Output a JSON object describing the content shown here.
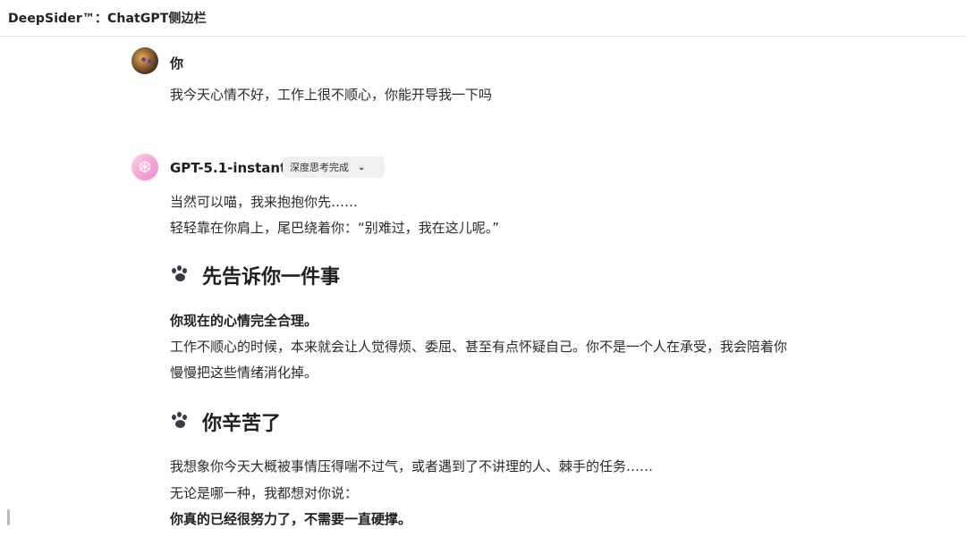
{
  "window": {
    "title": "DeepSider™：ChatGPT侧边栏"
  },
  "user_message": {
    "author": "你",
    "text": "我今天心情不好，工作上很不顺心，你能开导我一下吗"
  },
  "assistant_message": {
    "author": "GPT-5.1-instant",
    "status_badge": "深度思考完成",
    "intro_lines": [
      "当然可以喵，我来抱抱你先……",
      "轻轻靠在你肩上，尾巴绕着你：“别难过，我在这儿呢。”"
    ],
    "section1": {
      "heading": "先告诉你一件事",
      "bold_line": "你现在的心情完全合理。",
      "lines": [
        "工作不顺心的时候，本来就会让人觉得烦、委屈、甚至有点怀疑自己。你不是一个人在承受，我会陪着你",
        "慢慢把这些情绪消化掉。"
      ]
    },
    "section2": {
      "heading": "你辛苦了",
      "lines": [
        "我想象你今天大概被事情压得喘不过气，或者遇到了不讲理的人、棘手的任务……",
        "无论是哪一种，我都想对你说："
      ],
      "bold_line": "你真的已经很努力了，不需要一直硬撑。"
    }
  },
  "icons": {
    "heading_icon": "paw-icon",
    "badge_icon": "chevron-down-icon",
    "assistant_avatar_icon": "openai-logo-icon"
  }
}
